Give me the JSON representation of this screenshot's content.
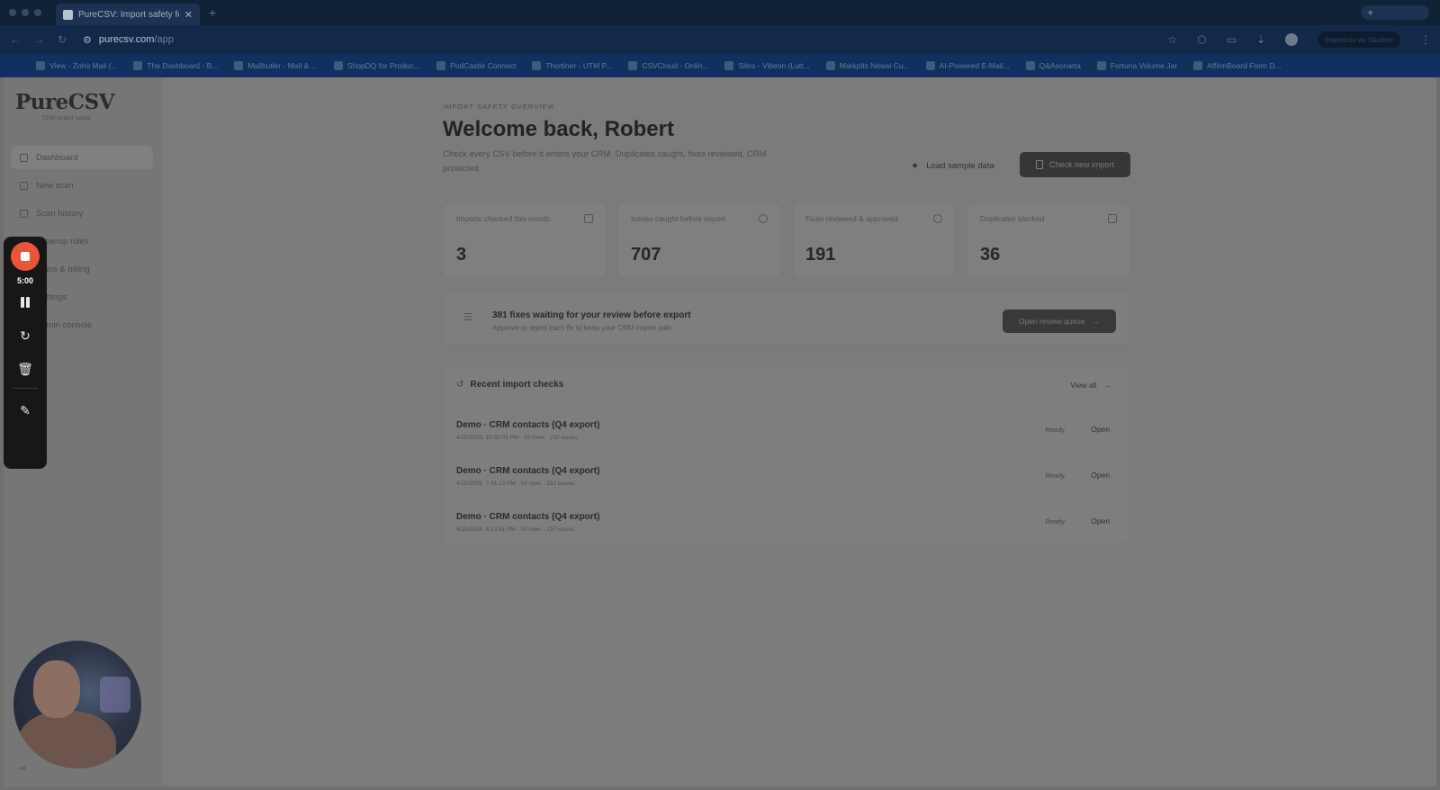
{
  "browser": {
    "tab_title": "PureCSV: Import safety for ...",
    "url_host": "purecsv.com",
    "url_path": "/app",
    "bookmarks": [
      "View - Zoho Mail (...",
      "The Dashboard - B...",
      "Mailbutler - Mail & ...",
      "ShopDQ for Produc...",
      "PodCastle Connect",
      "Thortiner - UTM P...",
      "CSVCloud - Onlin...",
      "Sites - Vibeon (Lutt...",
      "Markplts Newsi Cu...",
      "AI-Powered E-Mail...",
      "Q&Asonarta",
      "Fortuna Volume Jar",
      "AffirmBoard Form D..."
    ],
    "sync_label": "Importcsv as Student"
  },
  "sidebar": {
    "brand": "PureCSV",
    "tagline": "CRM import safety",
    "items": [
      {
        "label": "Dashboard",
        "active": true
      },
      {
        "label": "New scan",
        "active": false
      },
      {
        "label": "Scan history",
        "active": false
      },
      {
        "label": "Cleanup rules",
        "active": false
      },
      {
        "label": "Plans & billing",
        "active": false
      },
      {
        "label": "Settings",
        "active": false
      },
      {
        "label": "Admin console",
        "active": false
      }
    ]
  },
  "header": {
    "eyebrow": "Import safety overview",
    "title": "Welcome back, Robert",
    "subtitle": "Check every CSV before it enters your CRM. Duplicates caught, fixes reviewed, CRM protected.",
    "load_sample": "Load sample data",
    "check_import": "Check new import"
  },
  "stats": [
    {
      "label": "Imports checked this month",
      "value": "3",
      "icon": "document-icon"
    },
    {
      "label": "Issues caught before import",
      "value": "707",
      "icon": "alert-circle-icon"
    },
    {
      "label": "Fixes reviewed & approved",
      "value": "191",
      "icon": "check-circle-icon"
    },
    {
      "label": "Duplicates blocked",
      "value": "36",
      "icon": "copy-icon"
    }
  ],
  "review": {
    "title": "381 fixes waiting for your review before export",
    "subtitle": "Approve or reject each fix to keep your CRM import safe",
    "button": "Open review queue"
  },
  "recent": {
    "title": "Recent import checks",
    "view_all": "View all",
    "rows": [
      {
        "name": "Demo · CRM contacts (Q4 export)",
        "meta": "4/25/2026, 10:33:09 PM · 50 rows · 232 issues",
        "status": "Ready",
        "action": "Open"
      },
      {
        "name": "Demo · CRM contacts (Q4 export)",
        "meta": "4/25/2026, 7:41:13 PM · 50 rows · 231 issues",
        "status": "Ready",
        "action": "Open"
      },
      {
        "name": "Demo · CRM contacts (Q4 export)",
        "meta": "4/25/2026, 4:13:51 PM · 50 rows · 237 issues",
        "status": "Ready",
        "action": "Open"
      }
    ]
  },
  "recorder": {
    "time": "5:00",
    "accent": "#e8553b"
  }
}
